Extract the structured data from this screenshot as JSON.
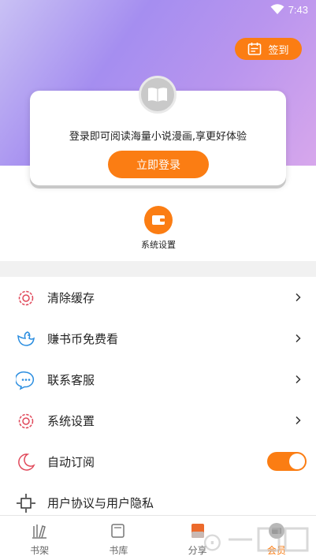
{
  "status_bar": {
    "time": "7:43"
  },
  "header": {
    "signin_label": "签到"
  },
  "login_card": {
    "tip": "登录即可阅读海量小说漫画,享更好体验",
    "button_label": "立即登录"
  },
  "quick_actions": [
    {
      "label": "系统设置",
      "icon": "wallet-icon"
    }
  ],
  "menu": {
    "items": [
      {
        "label": "清除缓存",
        "icon": "gear-icon"
      },
      {
        "label": "赚书币免费看",
        "icon": "bird-icon"
      },
      {
        "label": "联系客服",
        "icon": "chat-bubble-icon"
      },
      {
        "label": "系统设置",
        "icon": "gear-icon"
      },
      {
        "label": "自动订阅",
        "icon": "moon-icon",
        "toggle_on": true
      },
      {
        "label": "用户协议与用户隐私",
        "icon": "agreement-icon"
      }
    ]
  },
  "tabbar": {
    "items": [
      {
        "label": "书架",
        "icon": "bookshelf-icon"
      },
      {
        "label": "书库",
        "icon": "library-icon"
      },
      {
        "label": "分享",
        "icon": "share-icon"
      },
      {
        "label": "会员",
        "icon": "member-icon",
        "active": true
      }
    ]
  },
  "colors": {
    "accent": "#fb7d13",
    "hero_start": "#c9c1f4",
    "hero_end": "#d7a7ec"
  }
}
